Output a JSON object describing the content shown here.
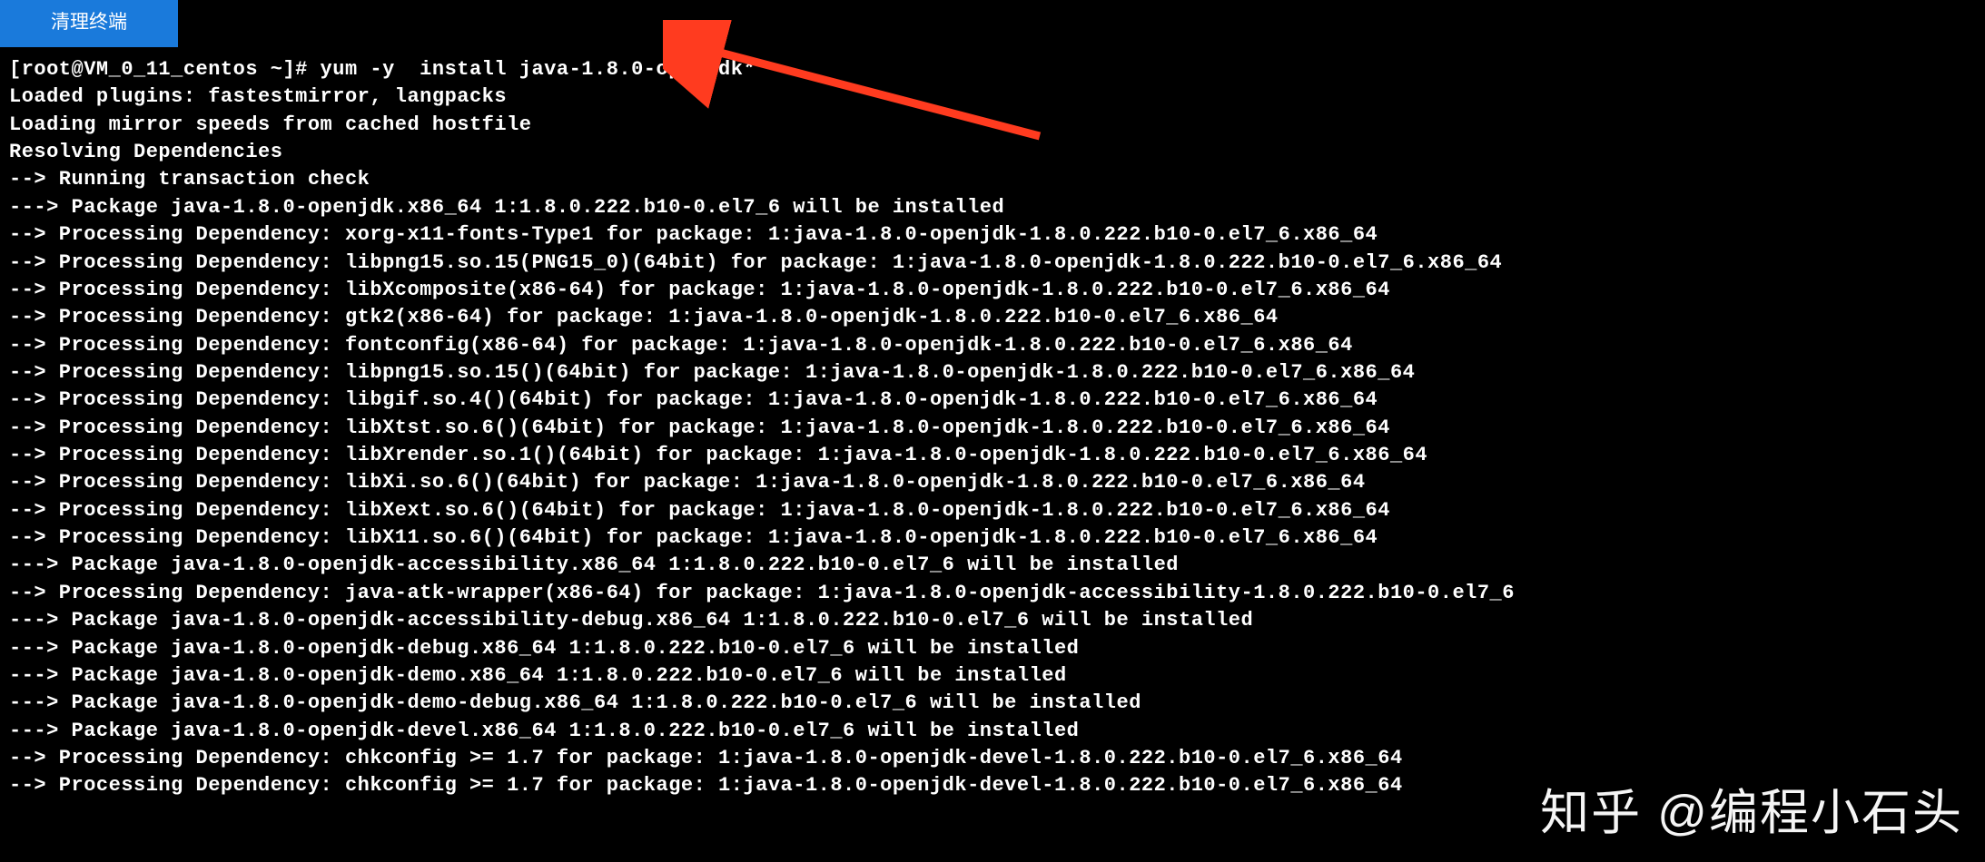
{
  "tab": {
    "label": "清理终端"
  },
  "terminal": {
    "lines": [
      "[root@VM_0_11_centos ~]# yum -y  install java-1.8.0-openjdk*",
      "Loaded plugins: fastestmirror, langpacks",
      "Loading mirror speeds from cached hostfile",
      "Resolving Dependencies",
      "--> Running transaction check",
      "---> Package java-1.8.0-openjdk.x86_64 1:1.8.0.222.b10-0.el7_6 will be installed",
      "--> Processing Dependency: xorg-x11-fonts-Type1 for package: 1:java-1.8.0-openjdk-1.8.0.222.b10-0.el7_6.x86_64",
      "--> Processing Dependency: libpng15.so.15(PNG15_0)(64bit) for package: 1:java-1.8.0-openjdk-1.8.0.222.b10-0.el7_6.x86_64",
      "--> Processing Dependency: libXcomposite(x86-64) for package: 1:java-1.8.0-openjdk-1.8.0.222.b10-0.el7_6.x86_64",
      "--> Processing Dependency: gtk2(x86-64) for package: 1:java-1.8.0-openjdk-1.8.0.222.b10-0.el7_6.x86_64",
      "--> Processing Dependency: fontconfig(x86-64) for package: 1:java-1.8.0-openjdk-1.8.0.222.b10-0.el7_6.x86_64",
      "--> Processing Dependency: libpng15.so.15()(64bit) for package: 1:java-1.8.0-openjdk-1.8.0.222.b10-0.el7_6.x86_64",
      "--> Processing Dependency: libgif.so.4()(64bit) for package: 1:java-1.8.0-openjdk-1.8.0.222.b10-0.el7_6.x86_64",
      "--> Processing Dependency: libXtst.so.6()(64bit) for package: 1:java-1.8.0-openjdk-1.8.0.222.b10-0.el7_6.x86_64",
      "--> Processing Dependency: libXrender.so.1()(64bit) for package: 1:java-1.8.0-openjdk-1.8.0.222.b10-0.el7_6.x86_64",
      "--> Processing Dependency: libXi.so.6()(64bit) for package: 1:java-1.8.0-openjdk-1.8.0.222.b10-0.el7_6.x86_64",
      "--> Processing Dependency: libXext.so.6()(64bit) for package: 1:java-1.8.0-openjdk-1.8.0.222.b10-0.el7_6.x86_64",
      "--> Processing Dependency: libX11.so.6()(64bit) for package: 1:java-1.8.0-openjdk-1.8.0.222.b10-0.el7_6.x86_64",
      "---> Package java-1.8.0-openjdk-accessibility.x86_64 1:1.8.0.222.b10-0.el7_6 will be installed",
      "--> Processing Dependency: java-atk-wrapper(x86-64) for package: 1:java-1.8.0-openjdk-accessibility-1.8.0.222.b10-0.el7_6",
      "---> Package java-1.8.0-openjdk-accessibility-debug.x86_64 1:1.8.0.222.b10-0.el7_6 will be installed",
      "---> Package java-1.8.0-openjdk-debug.x86_64 1:1.8.0.222.b10-0.el7_6 will be installed",
      "---> Package java-1.8.0-openjdk-demo.x86_64 1:1.8.0.222.b10-0.el7_6 will be installed",
      "---> Package java-1.8.0-openjdk-demo-debug.x86_64 1:1.8.0.222.b10-0.el7_6 will be installed",
      "---> Package java-1.8.0-openjdk-devel.x86_64 1:1.8.0.222.b10-0.el7_6 will be installed",
      "--> Processing Dependency: chkconfig >= 1.7 for package: 1:java-1.8.0-openjdk-devel-1.8.0.222.b10-0.el7_6.x86_64",
      "--> Processing Dependency: chkconfig >= 1.7 for package: 1:java-1.8.0-openjdk-devel-1.8.0.222.b10-0.el7_6.x86_64"
    ]
  },
  "watermark": {
    "text": "知乎 @编程小石头"
  },
  "annotation": {
    "arrow_color": "#ff3b1f"
  }
}
